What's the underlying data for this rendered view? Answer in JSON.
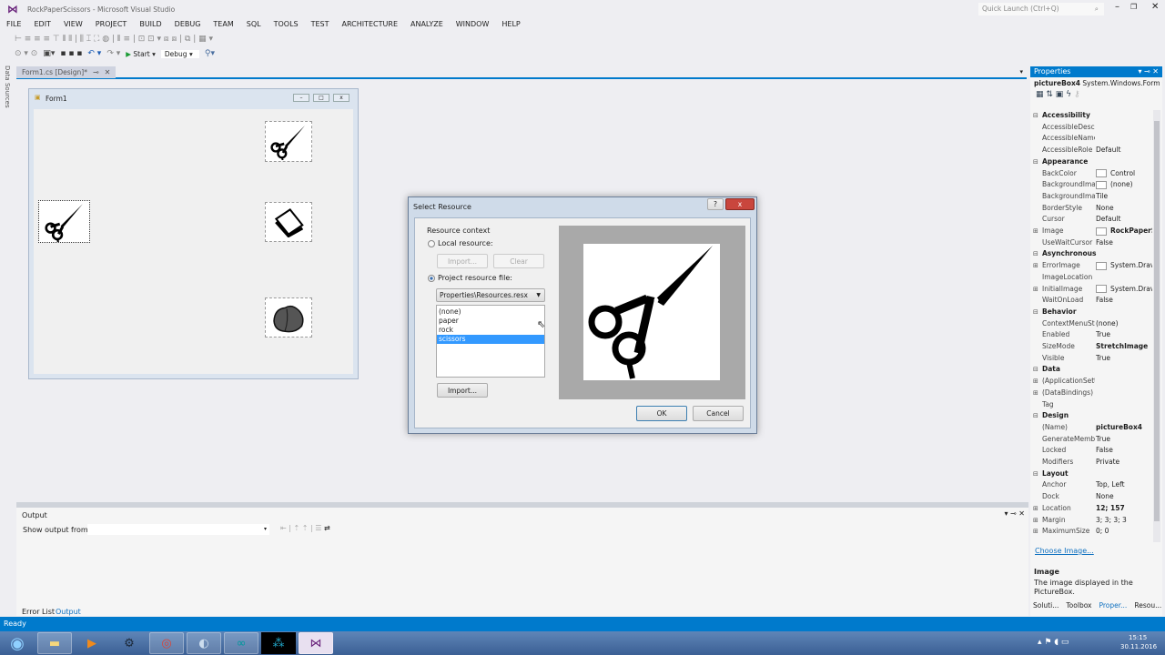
{
  "window": {
    "title": "RockPaperScissors - Microsoft Visual Studio",
    "quick_launch_placeholder": "Quick Launch (Ctrl+Q)"
  },
  "menu": [
    "FILE",
    "EDIT",
    "VIEW",
    "PROJECT",
    "BUILD",
    "DEBUG",
    "TEAM",
    "SQL",
    "TOOLS",
    "TEST",
    "ARCHITECTURE",
    "ANALYZE",
    "WINDOW",
    "HELP"
  ],
  "toolbar": {
    "start_label": "Start",
    "config_value": "Debug"
  },
  "doc_tab": {
    "label": "Form1.cs [Design]*"
  },
  "left_strip": {
    "label": "Data Sources"
  },
  "form": {
    "title": "Form1"
  },
  "dialog": {
    "title": "Select Resource",
    "group_label": "Resource context",
    "local_resource_label": "Local resource:",
    "import_label": "Import...",
    "clear_label": "Clear",
    "project_resource_label": "Project resource file:",
    "resource_file": "Properties\\Resources.resx",
    "resources": [
      "(none)",
      "paper",
      "rock",
      "scissors"
    ],
    "selected_resource": "scissors",
    "import2_label": "Import...",
    "ok_label": "OK",
    "cancel_label": "Cancel",
    "help_glyph": "?",
    "close_glyph": "x"
  },
  "output": {
    "title": "Output",
    "show_from_label": "Show output from:",
    "tabs": [
      "Error List",
      "Output"
    ],
    "active_tab": "Output"
  },
  "properties": {
    "title": "Properties",
    "object_name": "pictureBox4",
    "object_type": "System.Windows.Form",
    "rows": [
      {
        "cat": true,
        "name": "Accessibility"
      },
      {
        "name": "AccessibleDescr",
        "value": ""
      },
      {
        "name": "AccessibleName",
        "value": ""
      },
      {
        "name": "AccessibleRole",
        "value": "Default"
      },
      {
        "cat": true,
        "name": "Appearance"
      },
      {
        "name": "BackColor",
        "value": "Control",
        "swatch": true
      },
      {
        "name": "BackgroundImage",
        "value": "(none)",
        "swatch": true
      },
      {
        "name": "BackgroundImageLayout",
        "value": "Tile"
      },
      {
        "name": "BorderStyle",
        "value": "None"
      },
      {
        "name": "Cursor",
        "value": "Default"
      },
      {
        "name": "Image",
        "value": "RockPaperS",
        "bold": true,
        "expand": true,
        "swatch": true
      },
      {
        "name": "UseWaitCursor",
        "value": "False"
      },
      {
        "cat": true,
        "name": "Asynchronous"
      },
      {
        "name": "ErrorImage",
        "value": "System.Drav",
        "expand": true,
        "swatch": true
      },
      {
        "name": "ImageLocation",
        "value": ""
      },
      {
        "name": "InitialImage",
        "value": "System.Drav",
        "expand": true,
        "swatch": true
      },
      {
        "name": "WaitOnLoad",
        "value": "False"
      },
      {
        "cat": true,
        "name": "Behavior"
      },
      {
        "name": "ContextMenuStrip",
        "value": "(none)"
      },
      {
        "name": "Enabled",
        "value": "True"
      },
      {
        "name": "SizeMode",
        "value": "StretchImage",
        "bold": true
      },
      {
        "name": "Visible",
        "value": "True"
      },
      {
        "cat": true,
        "name": "Data"
      },
      {
        "name": "(ApplicationSettings)",
        "value": "",
        "expand": true
      },
      {
        "name": "(DataBindings)",
        "value": "",
        "expand": true
      },
      {
        "name": "Tag",
        "value": ""
      },
      {
        "cat": true,
        "name": "Design"
      },
      {
        "name": "(Name)",
        "value": "pictureBox4",
        "bold": true
      },
      {
        "name": "GenerateMember",
        "value": "True"
      },
      {
        "name": "Locked",
        "value": "False"
      },
      {
        "name": "Modifiers",
        "value": "Private"
      },
      {
        "cat": true,
        "name": "Layout"
      },
      {
        "name": "Anchor",
        "value": "Top, Left"
      },
      {
        "name": "Dock",
        "value": "None"
      },
      {
        "name": "Location",
        "value": "12; 157",
        "bold": true,
        "expand": true
      },
      {
        "name": "Margin",
        "value": "3; 3; 3; 3",
        "expand": true
      },
      {
        "name": "MaximumSize",
        "value": "0; 0",
        "expand": true
      }
    ],
    "link": "Choose Image...",
    "desc_title": "Image",
    "desc_text": "The image displayed in the PictureBox.",
    "tabs": [
      "Soluti...",
      "Toolbox",
      "Proper...",
      "Resou..."
    ]
  },
  "status": {
    "text": "Ready"
  },
  "taskbar": {
    "time": "15:15",
    "date": "30.11.2016"
  },
  "colors": {
    "accent": "#007acc",
    "selection": "#3399ff"
  }
}
